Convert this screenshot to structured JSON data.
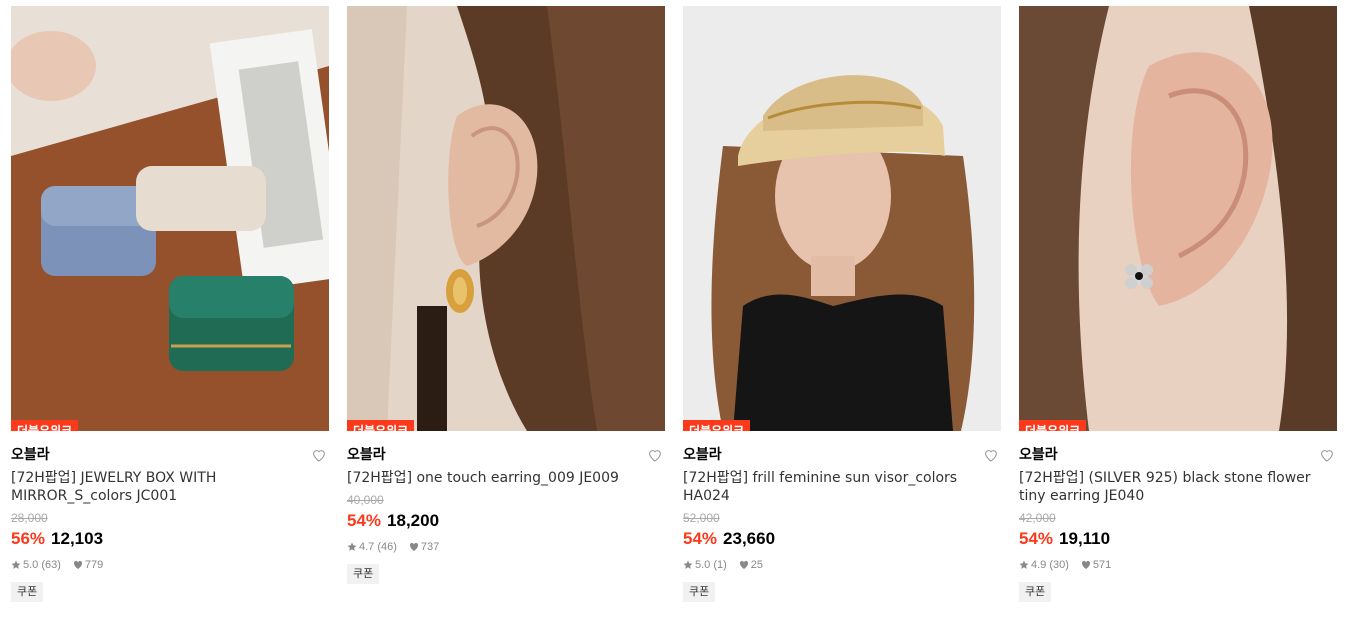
{
  "products": [
    {
      "badge": "더블유위크",
      "brand": "오블라",
      "title": "[72H팝업] JEWELRY BOX WITH MIRROR_S_colors JC001",
      "original_price": "28,000",
      "discount": "56%",
      "price": "12,103",
      "rating": "5.0 (63)",
      "likes": "779",
      "coupon": "쿠폰",
      "image_icon": "jewelry-box-image"
    },
    {
      "badge": "더블유위크",
      "brand": "오블라",
      "title": "[72H팝업] one touch earring_009 JE009",
      "original_price": "40,000",
      "discount": "54%",
      "price": "18,200",
      "rating": "4.7 (46)",
      "likes": "737",
      "coupon": "쿠폰",
      "image_icon": "gold-earring-image"
    },
    {
      "badge": "더블유위크",
      "brand": "오블라",
      "title": "[72H팝업] frill feminine sun visor_colors HA024",
      "original_price": "52,000",
      "discount": "54%",
      "price": "23,660",
      "rating": "5.0 (1)",
      "likes": "25",
      "coupon": "쿠폰",
      "image_icon": "sun-visor-model-image"
    },
    {
      "badge": "더블유위크",
      "brand": "오블라",
      "title": "[72H팝업] (SILVER 925) black stone flower tiny earring JE040",
      "original_price": "42,000",
      "discount": "54%",
      "price": "19,110",
      "rating": "4.9 (30)",
      "likes": "571",
      "coupon": "쿠폰",
      "image_icon": "flower-earring-image"
    }
  ],
  "colors": {
    "accent": "#fa3a1b",
    "badge_bg": "#fa3a1b",
    "coupon_bg": "#f1f1f1",
    "muted": "#888888"
  }
}
